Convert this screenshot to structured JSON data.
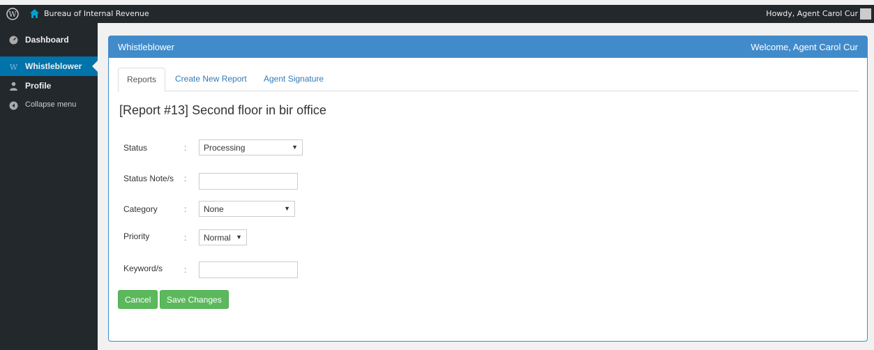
{
  "adminbar": {
    "site_name": "Bureau of Internal Revenue",
    "howdy": "Howdy, Agent Carol Cur"
  },
  "sidebar": {
    "items": [
      {
        "label": "Dashboard",
        "icon": "dashboard-icon"
      },
      {
        "label": "Whistleblower",
        "icon": "whistleblower-icon",
        "active": true
      },
      {
        "label": "Profile",
        "icon": "user-icon"
      },
      {
        "label": "Collapse menu",
        "icon": "collapse-icon"
      }
    ]
  },
  "panel": {
    "title": "Whistleblower",
    "welcome": "Welcome, Agent Carol Cur",
    "tabs": [
      {
        "label": "Reports",
        "active": true
      },
      {
        "label": "Create New Report"
      },
      {
        "label": "Agent Signature"
      }
    ],
    "report_title": "[Report #13] Second floor in bir office",
    "form": {
      "status_label": "Status",
      "status_value": "Processing",
      "status_note_label": "Status Note/s",
      "status_note_value": "",
      "category_label": "Category",
      "category_value": "None",
      "priority_label": "Priority",
      "priority_value": "Normal",
      "keyword_label": "Keyword/s",
      "keyword_value": "",
      "colon": ":"
    },
    "buttons": {
      "cancel": "Cancel",
      "save": "Save Changes"
    }
  },
  "colors": {
    "adminbar": "#23282d",
    "accent": "#0073aa",
    "panel_heading": "#428bca",
    "button": "#5cb85c"
  }
}
